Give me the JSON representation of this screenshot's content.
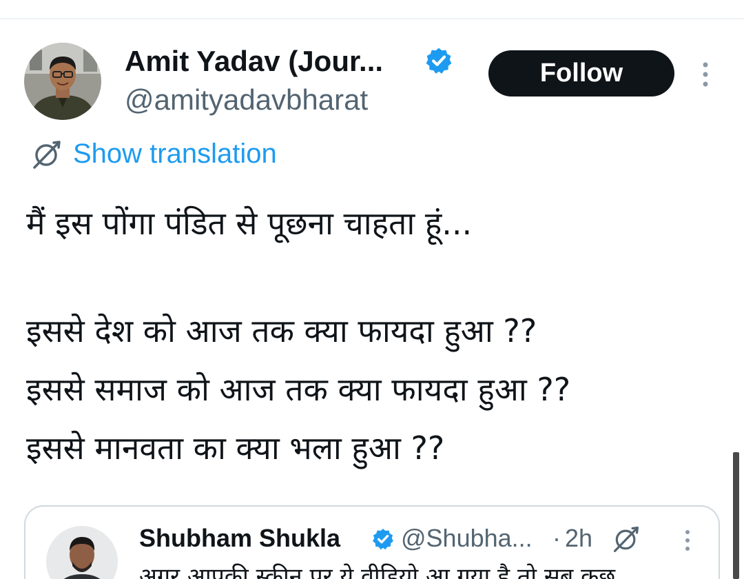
{
  "tweet": {
    "author": {
      "display_name": "Amit Yadav (Jour...",
      "handle": "@amityadavbharat",
      "verified": true,
      "avatar_icon": "profile-photo"
    },
    "follow_label": "Follow",
    "more_icon": "vertical-ellipsis-icon",
    "translation": {
      "icon": "translate-icon",
      "label": "Show translation"
    },
    "text_lines": [
      "मैं इस पोंगा पंडित से पूछना चाहता हूं...",
      "इससे देश को आज तक क्या फायदा हुआ ??",
      "इससे समाज को आज तक क्या फायदा हुआ ??",
      "इससे मानवता का क्या भला हुआ ??"
    ]
  },
  "quoted_tweet": {
    "display_name": "Shubham Shukla",
    "handle": "@Shubha...",
    "separator": "·",
    "time": "2h",
    "verified": true,
    "text_preview": "अगर आपकी स्क्रीन पर ये वीडियो आ गया है तो सब कुछ"
  },
  "colors": {
    "text_primary": "#0f1419",
    "text_secondary": "#536471",
    "link_blue": "#1d9bf0",
    "verified_blue": "#1d9bf0",
    "follow_bg": "#0f1419",
    "card_border": "#cfd9de"
  }
}
